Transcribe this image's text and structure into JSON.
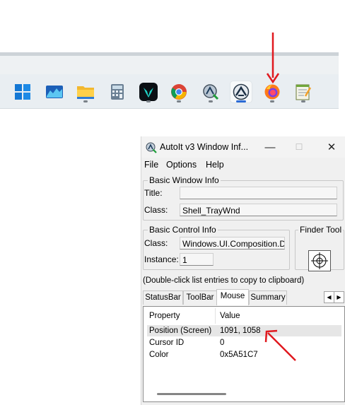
{
  "taskbar": {
    "icons": [
      {
        "name": "windows-start-icon",
        "active": false,
        "dot": false
      },
      {
        "name": "stock-chart-app-icon",
        "active": false,
        "dot": false
      },
      {
        "name": "file-explorer-icon",
        "active": false,
        "dot": true
      },
      {
        "name": "calculator-icon",
        "active": false,
        "dot": false
      },
      {
        "name": "predator-app-icon",
        "active": false,
        "dot": true
      },
      {
        "name": "chrome-icon",
        "active": false,
        "dot": true
      },
      {
        "name": "autoit-window-info-icon",
        "active": false,
        "dot": true
      },
      {
        "name": "autoit-icon",
        "active": true,
        "dot": true
      },
      {
        "name": "firefox-icon",
        "active": false,
        "dot": true
      },
      {
        "name": "notepad-icon",
        "active": false,
        "dot": true
      }
    ]
  },
  "window": {
    "title": "AutoIt v3 Window Inf...",
    "controls": {
      "minimize": "—",
      "maximize": "☐",
      "close": "✕"
    },
    "menu": [
      "File",
      "Options",
      "Help"
    ],
    "basic_window_info": {
      "legend": "Basic Window Info",
      "title_label": "Title:",
      "title_value": "",
      "class_label": "Class:",
      "class_value": "Shell_TrayWnd"
    },
    "basic_control_info": {
      "legend": "Basic Control Info",
      "class_label": "Class:",
      "class_value": "Windows.UI.Composition.Desk",
      "instance_label": "Instance:",
      "instance_value": "1"
    },
    "finder_tool": {
      "legend": "Finder Tool"
    },
    "hint": "(Double-click list entries to copy to clipboard)",
    "tabs": [
      {
        "label": "StatusBar",
        "selected": false
      },
      {
        "label": "ToolBar",
        "selected": false
      },
      {
        "label": "Mouse",
        "selected": true
      },
      {
        "label": "Summary",
        "selected": false
      }
    ],
    "tab_scroll": {
      "left": "◀",
      "right": "▶"
    },
    "list": {
      "columns": [
        "Property",
        "Value"
      ],
      "rows": [
        {
          "property": "Position (Screen)",
          "value": "1091, 1058",
          "selected": true
        },
        {
          "property": "Cursor ID",
          "value": "0",
          "selected": false
        },
        {
          "property": "Color",
          "value": "0x5A51C7",
          "selected": false
        }
      ]
    }
  },
  "annotations": {
    "arrow_color": "#e0191f"
  },
  "colors": {
    "taskbar_bg": "#e9eef2",
    "active_indicator": "#2b6bd6",
    "list_selected": "#e6e6e6"
  }
}
